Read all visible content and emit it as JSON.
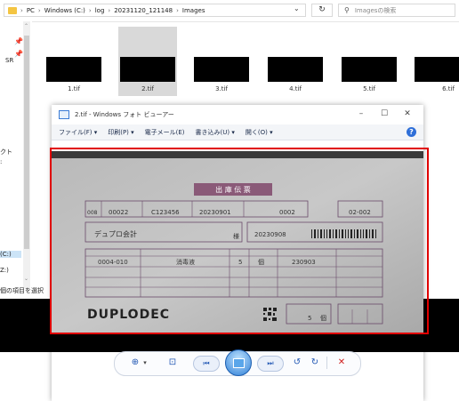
{
  "explorer": {
    "path": [
      "PC",
      "Windows (C:)",
      "log",
      "20231120_121148",
      "Images"
    ],
    "search_placeholder": "Imagesの検索",
    "thumbnails": [
      {
        "name": "1.tif",
        "selected": false
      },
      {
        "name": "2.tif",
        "selected": true
      },
      {
        "name": "3.tif",
        "selected": false
      },
      {
        "name": "4.tif",
        "selected": false
      },
      {
        "name": "5.tif",
        "selected": false
      },
      {
        "name": "6.tif",
        "selected": false
      }
    ],
    "left_fragments": {
      "sr": "SR",
      "kuto": "クト",
      "colon": ":",
      "drive_c": "(C:)",
      "drive_z": "Z:)",
      "status": "個の項目を選択"
    }
  },
  "viewer": {
    "title": "2.tif - Windows フォト ビューアー",
    "menu": [
      "ファイル(F) ▾",
      "印刷(P) ▾",
      "電子メール(E)",
      "書き込み(U) ▾",
      "開く(O) ▾"
    ],
    "help": "?",
    "window_controls": {
      "minimize": "–",
      "maximize": "☐",
      "close": "✕"
    },
    "document": {
      "heading": "出 庫 伝 票",
      "row1": [
        "008",
        "00022",
        "C123456",
        "20230901",
        "0002",
        "02-002"
      ],
      "customer": "デュプロ会計",
      "customer_suffix": "様",
      "date": "20230908",
      "item_code": "0004-010",
      "item_name": "消毒液",
      "qty": "5",
      "unit": "個",
      "lot": "230903",
      "brand": "DUPLODEC",
      "total_qty": "5",
      "total_unit": "個"
    },
    "toolbar": {
      "zoom": "⊕",
      "zoom_arrow": "▾",
      "fit": "⊡",
      "prev": "⏮",
      "next": "⏭",
      "rotate_ccw": "↺",
      "rotate_cw": "↻",
      "delete": "✕"
    }
  },
  "colors": {
    "highlight_border": "#e00000",
    "accent": "#1e55b3",
    "doc_ink": "#6a4a6a"
  }
}
